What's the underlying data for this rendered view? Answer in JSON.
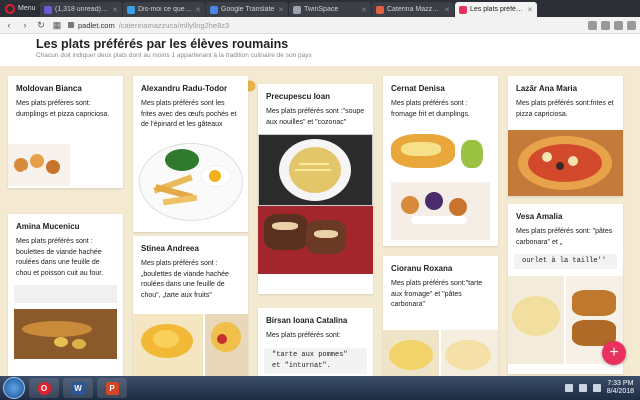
{
  "browser": {
    "menu_label": "Menu",
    "tabs": [
      {
        "label": "(1,318 unread) - com",
        "icon_color": "#6b5bd6",
        "active": false
      },
      {
        "label": "Dis-moi ce que tu m",
        "icon_color": "#3aa0e8",
        "active": false
      },
      {
        "label": "Google Translate",
        "icon_color": "#4a86e8",
        "active": false
      },
      {
        "label": "TwinSpace",
        "icon_color": "#9aa4b0",
        "active": false
      },
      {
        "label": "Caterina Mazzuca (c",
        "icon_color": "#e06040",
        "active": false
      },
      {
        "label": "Les plats préférés par",
        "icon_color": "#e8315e",
        "active": true
      }
    ],
    "url_host": "padlet.com",
    "url_path": "/caterinamazzuca/mllyllng2he8z3"
  },
  "padlet": {
    "title": "Les plats préférés par les élèves roumains",
    "subtitle": "Chacun doit indiquer deux plats dont au moins 1 appartenant à la tradition culinaire de son pays"
  },
  "cards": {
    "moldovan": {
      "title": "Moldovan Bianca",
      "body": "Mes plats préfères sont: dumplings et pizza capriciosa."
    },
    "amina": {
      "title": "Amina Mucenicu",
      "body": "Mes plats préférés sont : boulettes de viande hachée roulées dans une feuille de chou et poisson cuit au four."
    },
    "alexandru": {
      "title": "Alexandru Radu-Todor",
      "body": "Mes plats préférés sont les frites avec des œufs pochés et de l'épinard et les gâteaux"
    },
    "stinea": {
      "title": "Stinea Andreea",
      "body": "Mes plats préférés sont : „boulettes de viande hachée roulées dans une feuille de chou\", „tarte aux fruits\""
    },
    "precupescu": {
      "title": "Precupescu Ioan",
      "body": "Mes plats préférés sont :\"soupe aux nouilles\" et \"cozonac\""
    },
    "birsan": {
      "title": "Birsan Ioana Catalina",
      "body": "Mes plats préférés sont:",
      "mono": "\"tarte aux pommes\" et \"inturnat\"."
    },
    "cernat": {
      "title": "Cernat Denisa",
      "body": "Mes plats préférés sont : fromage frit et dumplings."
    },
    "cioranu": {
      "title": "Cioranu Roxana",
      "body": "Mes plats préférés sont:\"tarte aux fromage\" et \"pâtes carbonara\""
    },
    "lazar": {
      "title": "Lazăr Ana Maria",
      "body": "Mes plats préférés sont:frites et pizza capriciosa."
    },
    "vesa": {
      "title": "Vesa Amalia",
      "body": "Mes plats préférés sont: \"pâtes carbonara\" et „",
      "mono": "ourlet à la taille''"
    }
  },
  "taskbar": {
    "time": "7:33 PM",
    "date": "8/4/2018",
    "apps": [
      {
        "name": "opera",
        "color": "#e0202e",
        "glyph": "O"
      },
      {
        "name": "word",
        "color": "#2b5797",
        "glyph": "W"
      },
      {
        "name": "powerpoint",
        "color": "#d24726",
        "glyph": "P"
      }
    ]
  },
  "fab_label": "+"
}
